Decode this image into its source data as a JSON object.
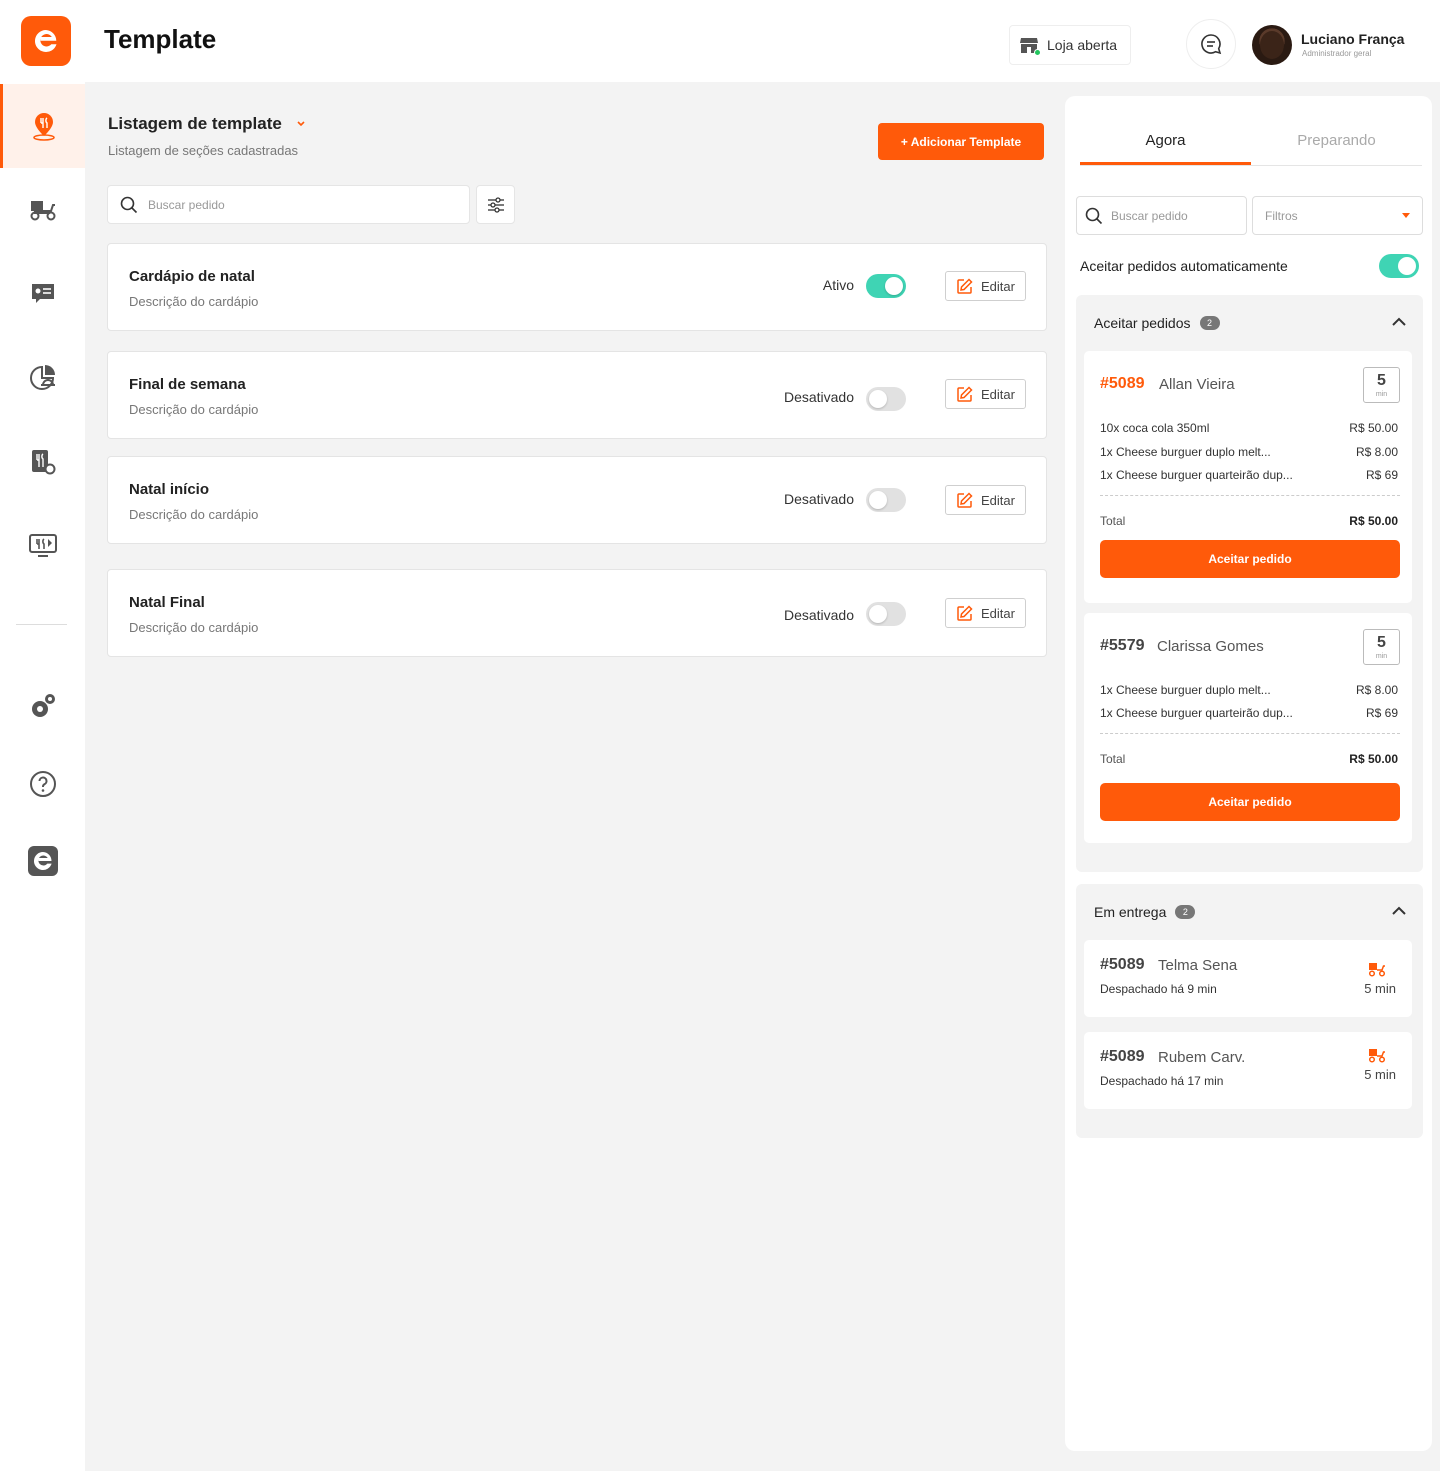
{
  "header": {
    "title": "Template",
    "store_status": "Loja aberta",
    "user_name": "Luciano França",
    "user_role": "Administrador geral"
  },
  "sidebar": {
    "items": [
      {
        "icon": "location-food-icon",
        "active": true
      },
      {
        "icon": "delivery-scooter-icon",
        "active": false
      },
      {
        "icon": "menu-card-icon",
        "active": false
      },
      {
        "icon": "chart-dish-icon",
        "active": false
      },
      {
        "icon": "restaurant-menu-icon",
        "active": false
      },
      {
        "icon": "food-monitor-icon",
        "active": false
      },
      {
        "icon": "settings-gears-icon",
        "active": false
      },
      {
        "icon": "help-icon",
        "active": false
      },
      {
        "icon": "brand-app-icon",
        "active": false
      }
    ]
  },
  "main": {
    "title": "Listagem de template",
    "subtitle": "Listagem de seções cadastradas",
    "add_button": "+ Adicionar Template",
    "search_placeholder": "Buscar pedido",
    "templates": [
      {
        "name": "Cardápio de natal",
        "description": "Descrição do cardápio",
        "status": "Ativo",
        "active": true,
        "edit_label": "Editar"
      },
      {
        "name": "Final de semana",
        "description": "Descrição do cardápio",
        "status": "Desativado",
        "active": false,
        "edit_label": "Editar"
      },
      {
        "name": "Natal início",
        "description": "Descrição do cardápio",
        "status": "Desativado",
        "active": false,
        "edit_label": "Editar"
      },
      {
        "name": "Natal Final",
        "description": "Descrição do cardápio",
        "status": "Desativado",
        "active": false,
        "edit_label": "Editar"
      }
    ]
  },
  "panel": {
    "tabs": [
      "Agora",
      "Preparando"
    ],
    "search_placeholder": "Buscar pedido",
    "filter_label": "Filtros",
    "auto_accept_label": "Aceitar pedidos automaticamente",
    "accept_section": {
      "title": "Aceitar pedidos",
      "count": "2",
      "orders": [
        {
          "id": "#5089",
          "customer": "Allan Vieira",
          "eta": "5",
          "eta_unit": "min",
          "items": [
            {
              "desc": "10x  coca cola 350ml",
              "price": "R$ 50.00"
            },
            {
              "desc": "1x  Cheese burguer duplo melt...",
              "price": "R$ 8.00"
            },
            {
              "desc": "1x  Cheese burguer quarteirão dup...",
              "price": "R$ 69"
            }
          ],
          "total_label": "Total",
          "total": "R$ 50.00",
          "button": "Aceitar pedido"
        },
        {
          "id": "#5579",
          "customer": "Clarissa Gomes",
          "eta": "5",
          "eta_unit": "min",
          "items": [
            {
              "desc": "1x  Cheese burguer duplo melt...",
              "price": "R$ 8.00"
            },
            {
              "desc": "1x  Cheese burguer quarteirão dup...",
              "price": "R$ 69"
            }
          ],
          "total_label": "Total",
          "total": "R$ 50.00",
          "button": "Aceitar pedido"
        }
      ]
    },
    "delivery_section": {
      "title": "Em entrega",
      "count": "2",
      "orders": [
        {
          "id": "#5089",
          "customer": "Telma Sena",
          "dispatched": "Despachado há 9 min",
          "time": "5 min"
        },
        {
          "id": "#5089",
          "customer": "Rubem Carv.",
          "dispatched": "Despachado há 17 min",
          "time": "5 min"
        }
      ]
    }
  },
  "colors": {
    "accent": "#ff5a0a",
    "toggle_on": "#3fd4b4"
  }
}
